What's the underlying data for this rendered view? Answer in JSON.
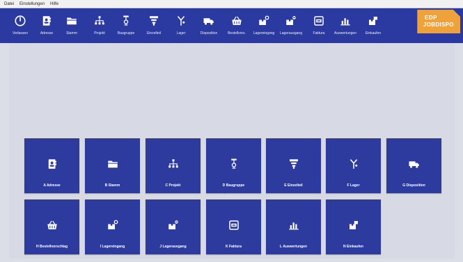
{
  "menubar": {
    "items": [
      "Datei",
      "Einstellungen",
      "Hilfe"
    ]
  },
  "toolbar": {
    "buttons": [
      {
        "label": "Verlassen",
        "icon": "power-icon"
      },
      {
        "label": "Adresse",
        "icon": "address-book-icon"
      },
      {
        "label": "Stamm",
        "icon": "folder-icon"
      },
      {
        "label": "Projekt",
        "icon": "hierarchy-icon"
      },
      {
        "label": "Baugruppe",
        "icon": "assembly-icon"
      },
      {
        "label": "Einzelteil",
        "icon": "part-icon"
      },
      {
        "label": "Lager",
        "icon": "storage-icon"
      },
      {
        "label": "Disposition",
        "icon": "truck-icon"
      },
      {
        "label": "Bestellvors.",
        "icon": "basket-icon"
      },
      {
        "label": "Lagereingang",
        "icon": "box-in-icon"
      },
      {
        "label": "Lagerausgang",
        "icon": "box-out-icon"
      },
      {
        "label": "Faktura",
        "icon": "invoice-icon"
      },
      {
        "label": "Auswertungen",
        "icon": "bar-chart-icon"
      },
      {
        "label": "Einkaufen",
        "icon": "cart-box-icon"
      }
    ]
  },
  "brand": {
    "line1": "EDP",
    "line2": "JOBDISPO"
  },
  "tiles": [
    {
      "label": "A Adresse",
      "icon": "address-book-icon"
    },
    {
      "label": "B Stamm",
      "icon": "folder-icon"
    },
    {
      "label": "C Projekt",
      "icon": "hierarchy-icon"
    },
    {
      "label": "D Baugruppe",
      "icon": "assembly-icon"
    },
    {
      "label": "E Einzelteil",
      "icon": "part-icon"
    },
    {
      "label": "F Lager",
      "icon": "storage-icon"
    },
    {
      "label": "G Disposition",
      "icon": "truck-icon"
    },
    {
      "label": "H Bestellvorschlag",
      "icon": "basket-icon"
    },
    {
      "label": "I Lagereingang",
      "icon": "box-in-icon"
    },
    {
      "label": "J Lagerausgang",
      "icon": "box-out-icon"
    },
    {
      "label": "K Faktura",
      "icon": "invoice-icon"
    },
    {
      "label": "L Auswertungen",
      "icon": "bar-chart-icon"
    },
    {
      "label": "N Einkaufen",
      "icon": "cart-box-icon"
    }
  ],
  "colors": {
    "toolbar": "#2b3aa0",
    "tile": "#2d3b9e",
    "brand": "#f0a23a",
    "background": "#d7d9e4"
  }
}
